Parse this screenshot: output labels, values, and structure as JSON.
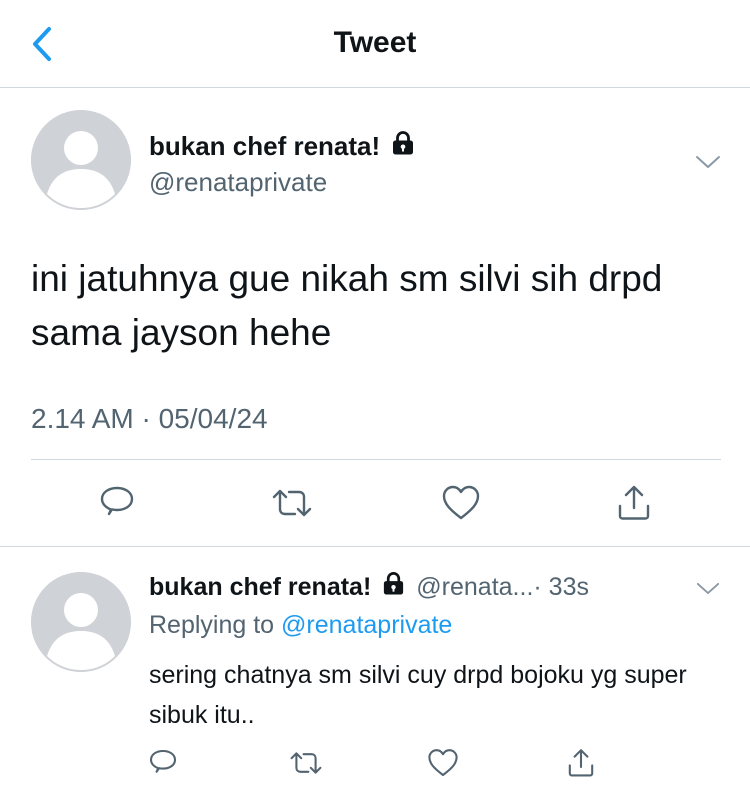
{
  "header": {
    "title": "Tweet",
    "back_icon": "chevron-left-icon",
    "accent_color": "#1d9bf0"
  },
  "tweet": {
    "display_name": "bukan chef renata!",
    "handle": "@renataprivate",
    "protected_icon": "lock-icon",
    "text": "ini jatuhnya gue nikah sm silvi sih drpd sama jayson hehe",
    "timestamp": "2.14 AM · 05/04/24",
    "actions": [
      "reply-icon",
      "retweet-icon",
      "like-icon",
      "share-icon"
    ]
  },
  "reply": {
    "display_name": "bukan chef renata!",
    "handle": "@renata...",
    "time": " · 33s",
    "replying_prefix": "Replying to ",
    "replying_handle": "@renataprivate",
    "text": "sering chatnya sm silvi cuy drpd bojoku yg super sibuk itu..",
    "actions": [
      "reply-icon",
      "retweet-icon",
      "like-icon",
      "share-icon"
    ]
  }
}
